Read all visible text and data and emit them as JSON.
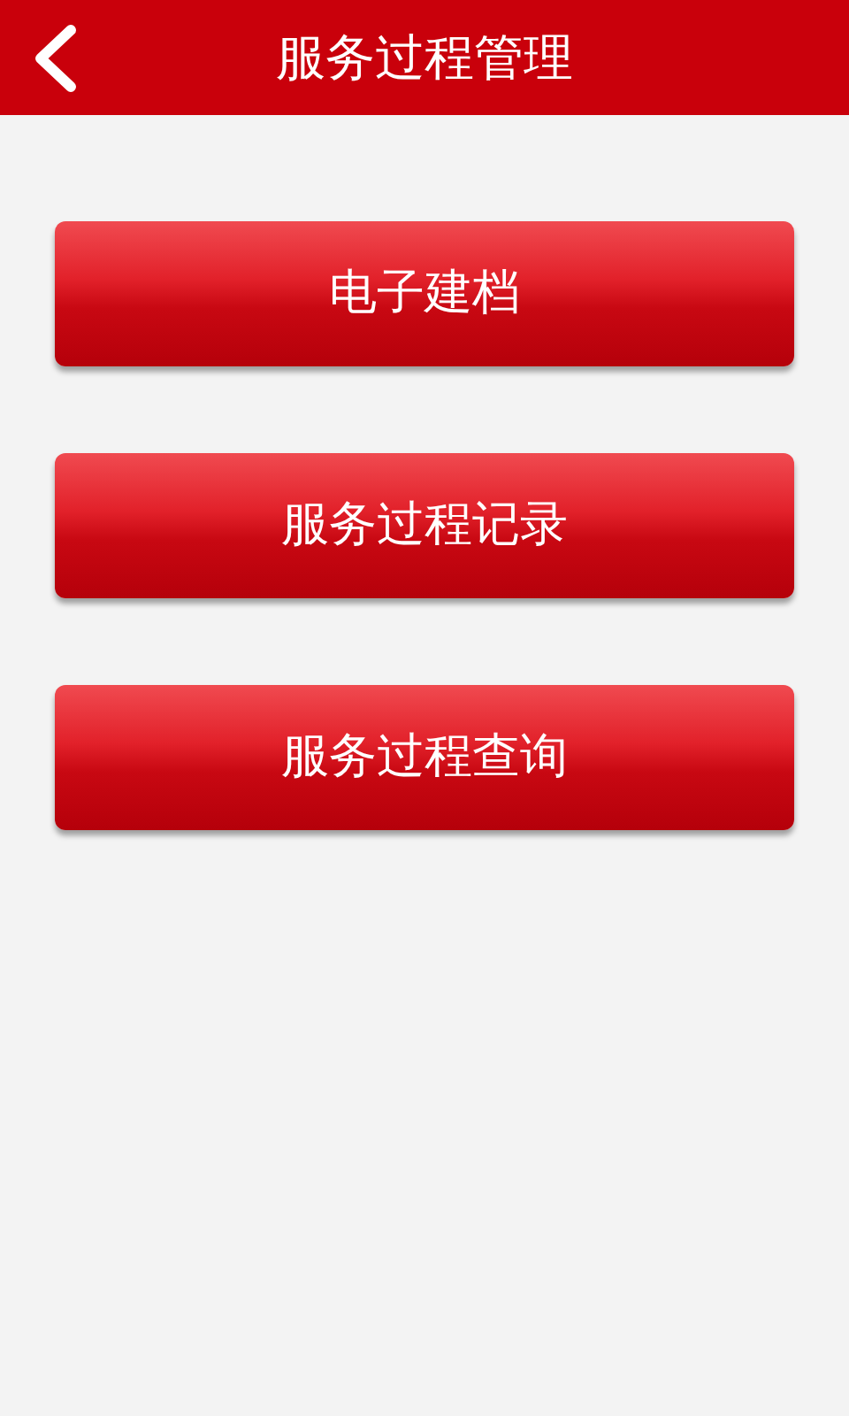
{
  "header": {
    "title": "服务过程管理"
  },
  "buttons": [
    {
      "label": "电子建档"
    },
    {
      "label": "服务过程记录"
    },
    {
      "label": "服务过程查询"
    }
  ]
}
